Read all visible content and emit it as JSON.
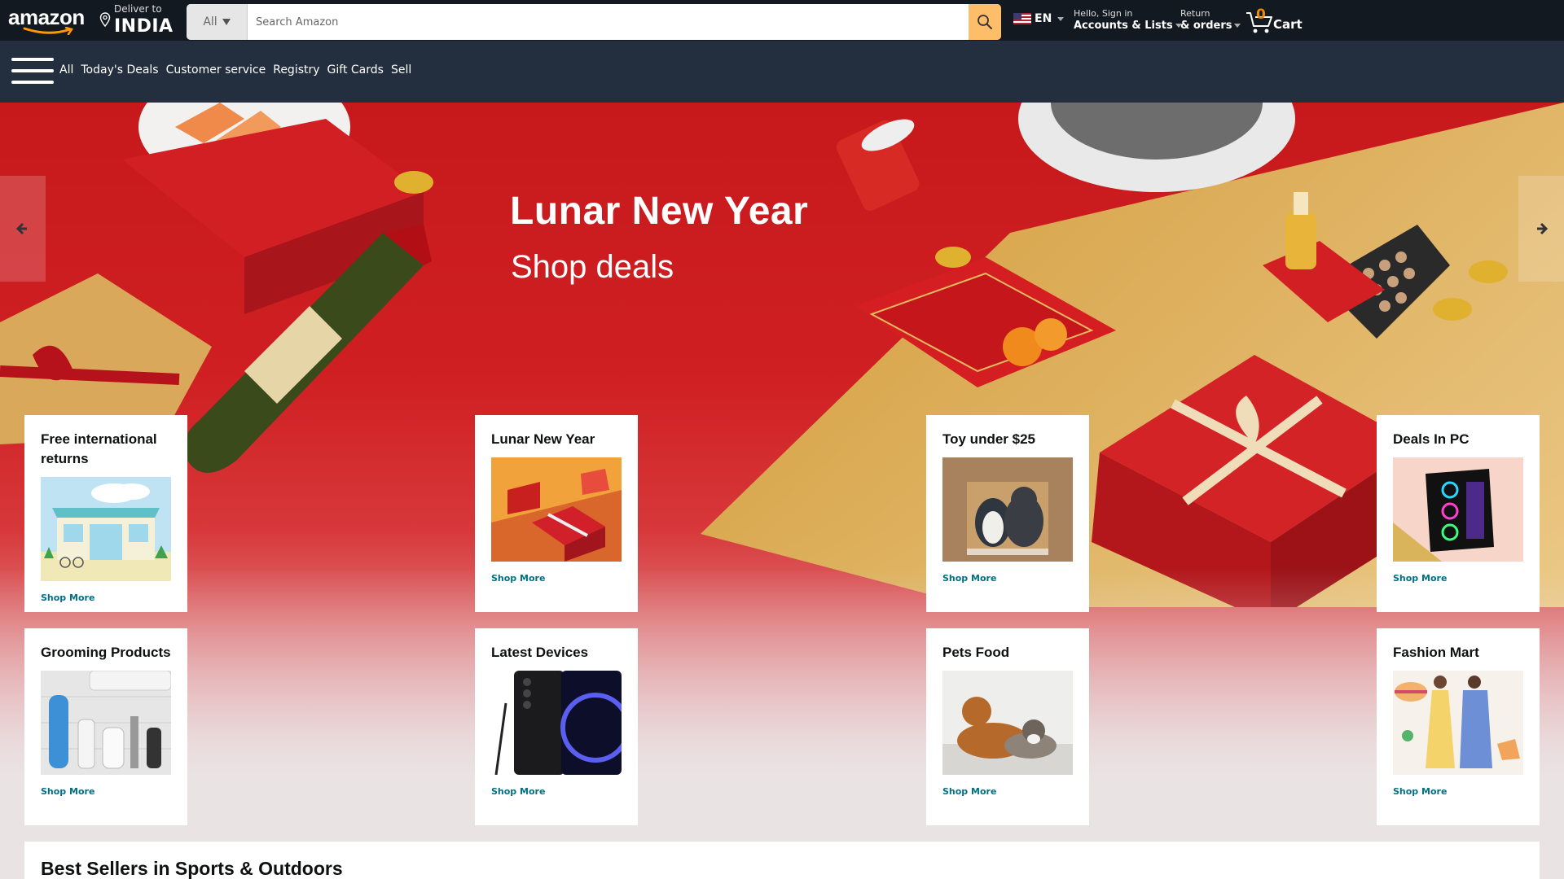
{
  "header": {
    "logo_text": "amazon",
    "deliver_to_label": "Deliver to",
    "deliver_to_location": "INDIA",
    "search_category": "All",
    "search_placeholder": "Search Amazon",
    "language": "EN",
    "account_line1": "Hello, Sign in",
    "account_line2": "Accounts & Lists",
    "orders_line1": "Return",
    "orders_line2": "& orders",
    "cart_count": "0",
    "cart_label": "Cart"
  },
  "subnav": {
    "all_label": "All",
    "links": [
      "Today's Deals",
      "Customer service",
      "Registry",
      "Gift Cards",
      "Sell"
    ]
  },
  "hero": {
    "title": "Lunar New Year",
    "subtitle": "Shop deals"
  },
  "cards": [
    {
      "title": "Free international returns",
      "link": "Shop More",
      "image": "storefront-illustration"
    },
    {
      "title": "Lunar New Year",
      "link": "Shop More",
      "image": "gift-boxes"
    },
    {
      "title": "Toy under $25",
      "link": "Shop More",
      "image": "plush-toys"
    },
    {
      "title": "Deals In PC",
      "link": "Shop More",
      "image": "gaming-pc"
    },
    {
      "title": "Grooming Products",
      "link": "Shop More",
      "image": "grooming-kit"
    },
    {
      "title": "Latest Devices",
      "link": "Shop More",
      "image": "smartphone"
    },
    {
      "title": "Pets Food",
      "link": "Shop More",
      "image": "dog-and-cat"
    },
    {
      "title": "Fashion Mart",
      "link": "Shop More",
      "image": "fashion-models"
    }
  ],
  "best_sellers": {
    "title": "Best Sellers in Sports & Outdoors"
  },
  "colors": {
    "nav_dark": "#131921",
    "subnav": "#232f3e",
    "search_button": "#febd69",
    "link": "#007185",
    "hero_red": "#c7191c",
    "cart_count": "#f08804"
  }
}
